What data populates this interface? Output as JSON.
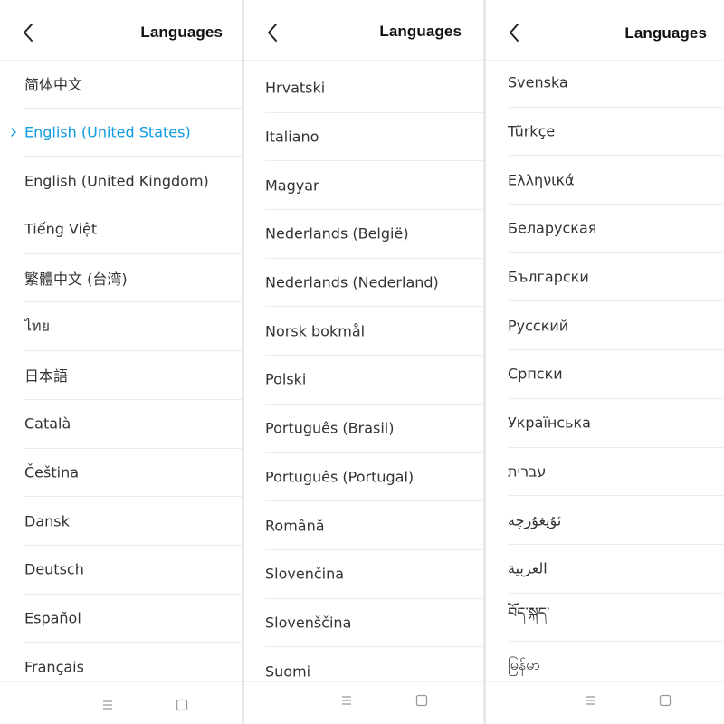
{
  "colors": {
    "accent": "#0e9be0",
    "text": "#333333",
    "title": "#111111",
    "divider": "#ececec"
  },
  "panels": [
    {
      "title": "Languages",
      "back_icon": "chevron-left-icon",
      "items": [
        {
          "label": "简体中文"
        },
        {
          "label": "English (United States)",
          "selected": true
        },
        {
          "label": "English (United Kingdom)"
        },
        {
          "label": "Tiếng Việt"
        },
        {
          "label": "繁體中文 (台湾)"
        },
        {
          "label": "ไทย"
        },
        {
          "label": "日本語"
        },
        {
          "label": "Català"
        },
        {
          "label": "Čeština"
        },
        {
          "label": "Dansk"
        },
        {
          "label": "Deutsch"
        },
        {
          "label": "Español"
        },
        {
          "label": "Français"
        }
      ]
    },
    {
      "title": "Languages",
      "back_icon": "chevron-left-icon",
      "items": [
        {
          "label": "Hrvatski"
        },
        {
          "label": "Italiano"
        },
        {
          "label": "Magyar"
        },
        {
          "label": "Nederlands (België)"
        },
        {
          "label": "Nederlands (Nederland)"
        },
        {
          "label": "Norsk bokmål"
        },
        {
          "label": "Polski"
        },
        {
          "label": "Português (Brasil)"
        },
        {
          "label": "Português (Portugal)"
        },
        {
          "label": "Română"
        },
        {
          "label": "Slovenčina"
        },
        {
          "label": "Slovenščina"
        },
        {
          "label": "Suomi"
        }
      ]
    },
    {
      "title": "Languages",
      "back_icon": "chevron-left-icon",
      "items": [
        {
          "label": "Svenska"
        },
        {
          "label": "Türkçe"
        },
        {
          "label": "Ελληνικά"
        },
        {
          "label": "Беларуская"
        },
        {
          "label": "Български"
        },
        {
          "label": "Русский"
        },
        {
          "label": "Српски"
        },
        {
          "label": "Українська"
        },
        {
          "label": "עברית"
        },
        {
          "label": "ئۇيغۇرچە"
        },
        {
          "label": "العربية"
        },
        {
          "label": "བོད་སྐད་"
        },
        {
          "label": "မြန်မာ"
        }
      ]
    }
  ],
  "navbar": {
    "menu_icon": "menu-lines-icon",
    "home_icon": "square-home-icon"
  }
}
